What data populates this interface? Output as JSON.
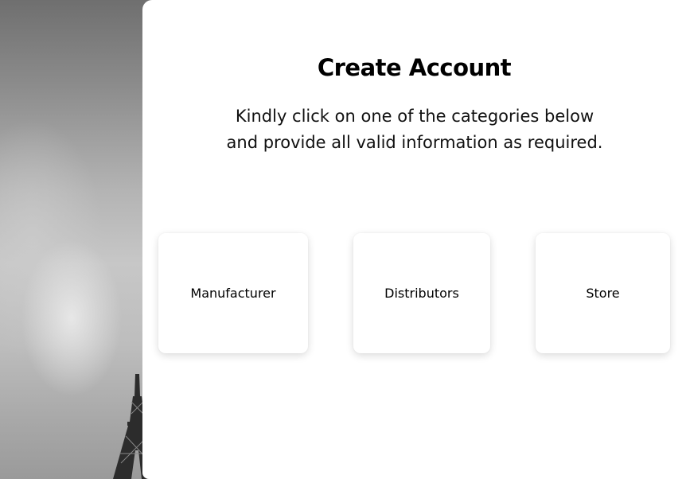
{
  "signup": {
    "title": "Create Account",
    "instruction_line1": "Kindly click on one of the categories below",
    "instruction_line2": "and provide all valid information as required.",
    "categories": [
      {
        "label": "Manufacturer"
      },
      {
        "label": "Distributors"
      },
      {
        "label": "Store"
      }
    ]
  }
}
